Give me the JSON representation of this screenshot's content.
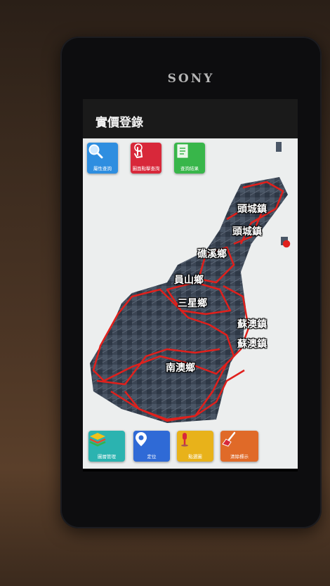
{
  "device": {
    "brand": "SONY"
  },
  "app": {
    "title": "實價登錄"
  },
  "toolbar_top": [
    {
      "label": "屬性查詢",
      "icon": "magnifier-icon",
      "color": "#2e8ee0"
    },
    {
      "label": "圖面點擊查詢",
      "icon": "tap-hand-icon",
      "color": "#d8283a"
    },
    {
      "label": "查詢結果",
      "icon": "list-document-icon",
      "color": "#38b64a"
    }
  ],
  "toolbar_bottom": [
    {
      "label": "圖層管理",
      "icon": "layers-icon",
      "color": "#2bb3b0"
    },
    {
      "label": "定位",
      "icon": "location-pin-icon",
      "color": "#2f6ad6"
    },
    {
      "label": "點選圖",
      "icon": "marker-icon",
      "color": "#e8b21a"
    },
    {
      "label": "清除標示",
      "icon": "broom-icon",
      "color": "#e06a28"
    }
  ],
  "map": {
    "boundary_color": "#e0201c",
    "labels": [
      "頭城鎮",
      "頭城鎮",
      "礁溪鄉",
      "員山鄉",
      "三星鄉",
      "蘇澳鎮",
      "蘇澳鎮",
      "南澳鄉"
    ]
  }
}
